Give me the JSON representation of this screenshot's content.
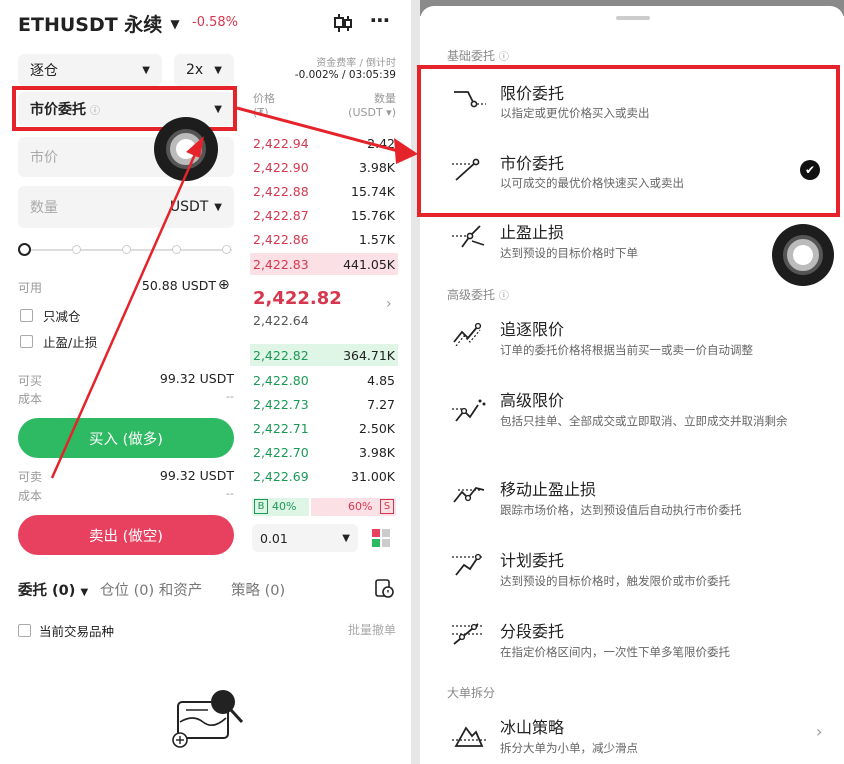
{
  "left": {
    "symbol": "ETHUSDT 永续",
    "change": "-0.58%",
    "margin_mode": "逐仓",
    "leverage": "2x",
    "funding_label": "资金费率 / 倒计时",
    "funding_value": "-0.002% / 03:05:39",
    "order_type": "市价委托",
    "price_field": "市价",
    "qty_placeholder": "数量",
    "qty_unit": "USDT",
    "available_label": "可用",
    "available_value": "50.88 USDT",
    "reduce_only": "只减仓",
    "tp_sl": "止盈/止损",
    "can_buy_label": "可买",
    "can_buy_value": "99.32 USDT",
    "cost_label": "成本",
    "cost_value": "--",
    "buy_button": "买入 (做多)",
    "can_sell_label": "可卖",
    "can_sell_value": "99.32 USDT",
    "cost2_label": "成本",
    "cost2_value": "--",
    "sell_button": "卖出 (做空)",
    "book_price_header": "价格",
    "book_price_unit": "(₮)",
    "book_qty_header": "数量",
    "book_qty_unit": "(USDT ▾)",
    "asks": [
      {
        "price": "2,422.94",
        "qty": "2.42"
      },
      {
        "price": "2,422.90",
        "qty": "3.98K"
      },
      {
        "price": "2,422.88",
        "qty": "15.74K"
      },
      {
        "price": "2,422.87",
        "qty": "15.76K"
      },
      {
        "price": "2,422.86",
        "qty": "1.57K"
      },
      {
        "price": "2,422.83",
        "qty": "441.05K"
      }
    ],
    "last_price": "2,422.82",
    "mark_price": "2,422.64",
    "bids": [
      {
        "price": "2,422.82",
        "qty": "364.71K"
      },
      {
        "price": "2,422.80",
        "qty": "4.85"
      },
      {
        "price": "2,422.73",
        "qty": "7.27"
      },
      {
        "price": "2,422.71",
        "qty": "2.50K"
      },
      {
        "price": "2,422.70",
        "qty": "3.98K"
      },
      {
        "price": "2,422.69",
        "qty": "31.00K"
      }
    ],
    "buy_ratio_label": "B",
    "buy_ratio": "40%",
    "sell_ratio": "60%",
    "sell_ratio_label": "S",
    "buy_ratio_value": 0.4,
    "precision": "0.01",
    "tab_orders": "委托 (0)",
    "tab_positions": "仓位 (0) 和资产",
    "tab_strategy": "策略 (0)",
    "current_only": "当前交易品种",
    "cancel_all": "批量撤单"
  },
  "sheet": {
    "section_basic": "基础委托",
    "section_advanced": "高级委托",
    "section_split": "大单拆分",
    "items": [
      {
        "title": "限价委托",
        "desc": "以指定或更优价格买入或卖出",
        "icon": "limit-order-icon"
      },
      {
        "title": "市价委托",
        "desc": "以可成交的最优价格快速买入或卖出",
        "icon": "market-order-icon"
      },
      {
        "title": "止盈止损",
        "desc": "达到预设的目标价格时下单",
        "icon": "tp-sl-icon"
      },
      {
        "title": "追逐限价",
        "desc": "订单的委托价格将根据当前买一或卖一价自动调整",
        "icon": "chase-limit-icon"
      },
      {
        "title": "高级限价",
        "desc": "包括只挂单、全部成交或立即取消、立即成交并取消剩余",
        "icon": "advanced-limit-icon"
      },
      {
        "title": "移动止盈止损",
        "desc": "跟踪市场价格，达到预设值后自动执行市价委托",
        "icon": "trailing-stop-icon"
      },
      {
        "title": "计划委托",
        "desc": "达到预设的目标价格时，触发限价或市价委托",
        "icon": "trigger-order-icon"
      },
      {
        "title": "分段委托",
        "desc": "在指定价格区间内，一次性下单多笔限价委托",
        "icon": "scaled-order-icon"
      },
      {
        "title": "冰山策略",
        "desc": "拆分大单为小单，减少滑点",
        "icon": "iceberg-icon"
      }
    ]
  },
  "colors": {
    "buy": "#2dba63",
    "sell": "#e8405f",
    "highlight": "#e4232b"
  }
}
